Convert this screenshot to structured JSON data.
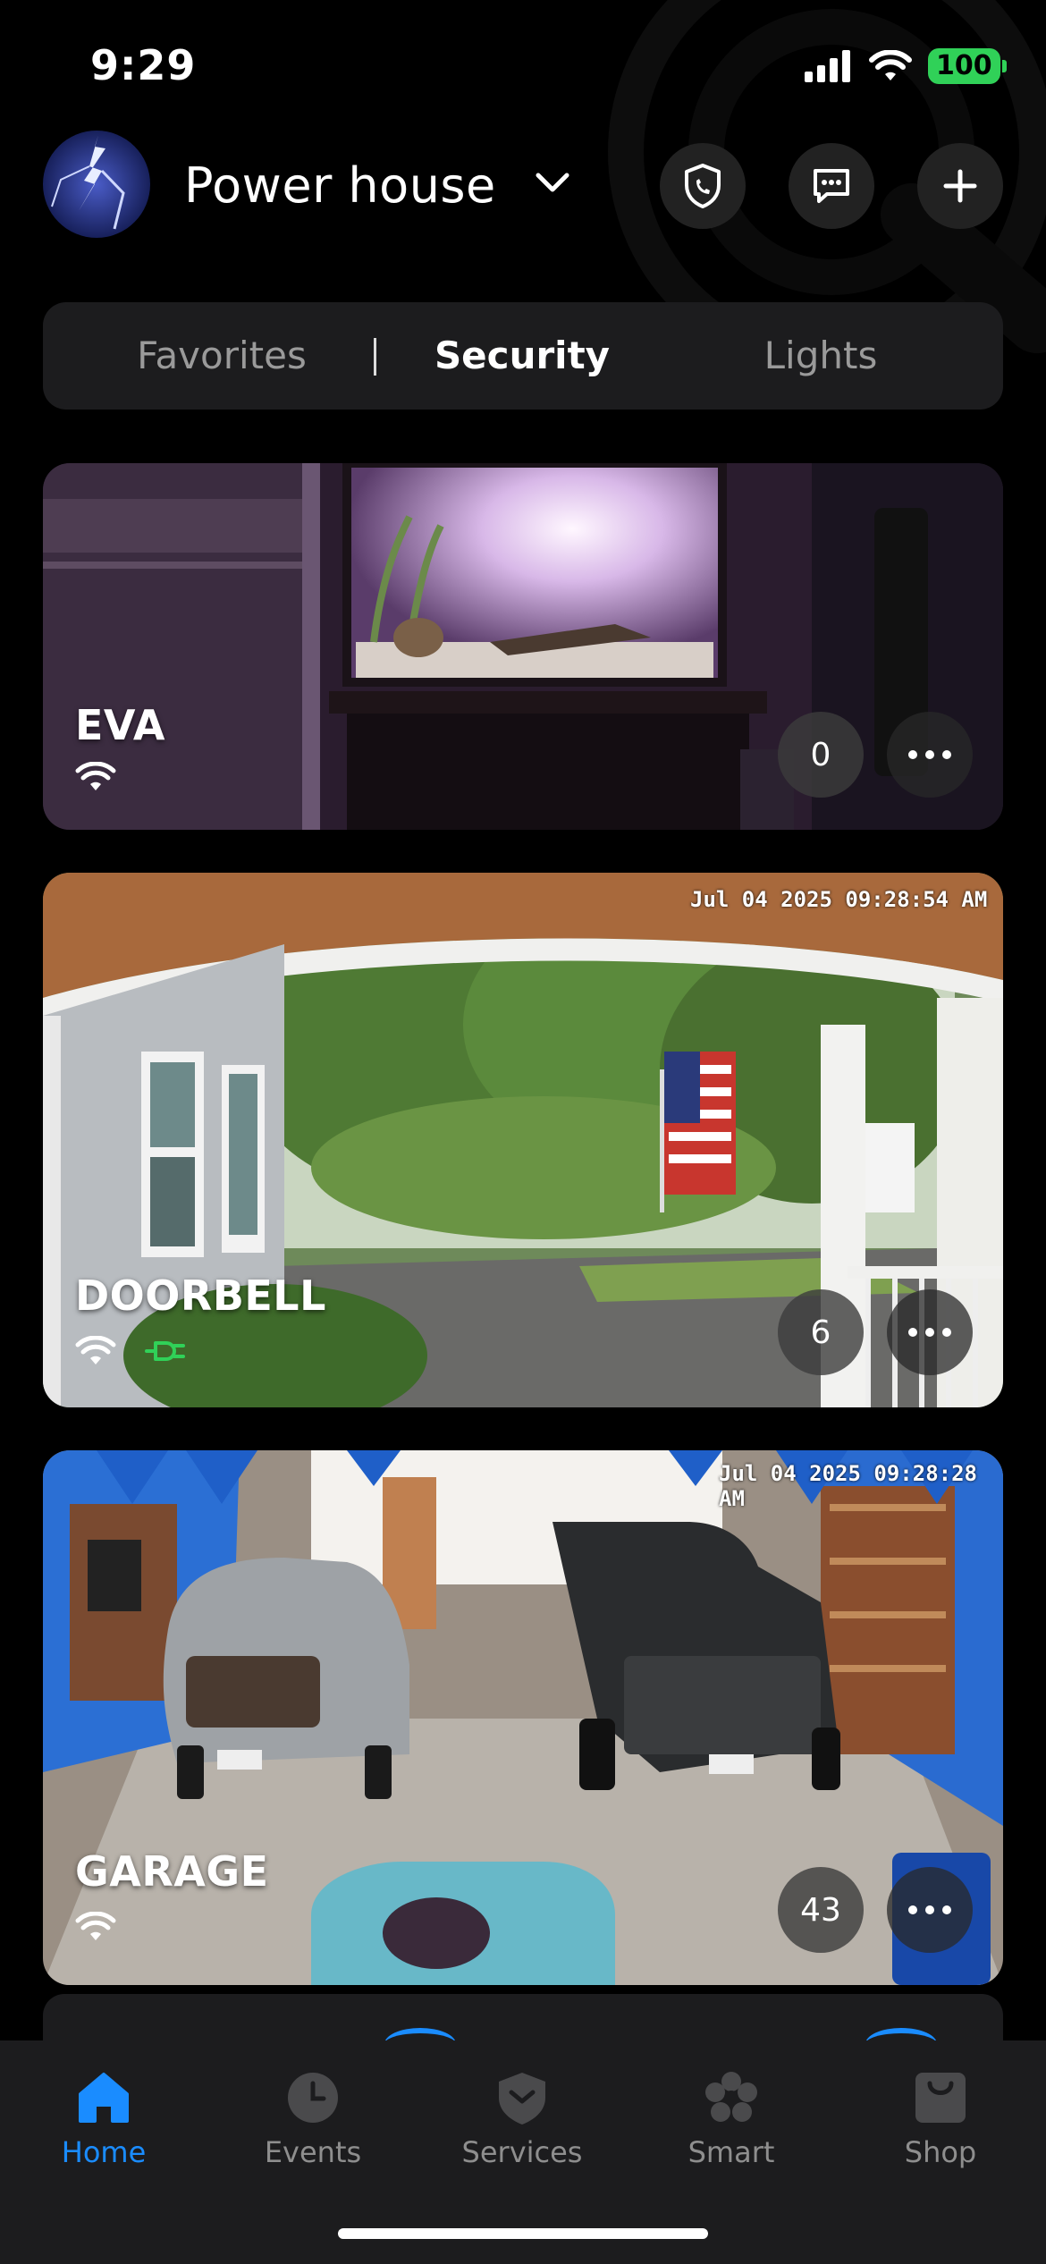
{
  "status_bar": {
    "time": "9:29",
    "battery": "100"
  },
  "header": {
    "title": "Power house",
    "icons": [
      "shield-phone-icon",
      "message-icon",
      "plus-icon"
    ]
  },
  "tabs": [
    {
      "label": "Favorites",
      "active": false
    },
    {
      "label": "Security",
      "active": true
    },
    {
      "label": "Lights",
      "active": false
    }
  ],
  "cameras": [
    {
      "name": "EVA",
      "event_count": "0",
      "timestamp": "",
      "powered": false
    },
    {
      "name": "DOORBELL",
      "event_count": "6",
      "timestamp": "Jul 04 2025  09:28:54 AM",
      "powered": true
    },
    {
      "name": "GARAGE",
      "event_count": "43",
      "timestamp": "Jul 04 2025  09:28:28 AM",
      "powered": false
    }
  ],
  "nav": [
    {
      "label": "Home",
      "icon": "home-icon",
      "active": true
    },
    {
      "label": "Events",
      "icon": "clock-icon",
      "active": false
    },
    {
      "label": "Services",
      "icon": "shield-icon",
      "active": false
    },
    {
      "label": "Smart",
      "icon": "smart-flower-icon",
      "active": false
    },
    {
      "label": "Shop",
      "icon": "shop-bag-icon",
      "active": false
    }
  ],
  "colors": {
    "accent": "#1a8cff",
    "battery": "#30d158",
    "plug": "#30d158"
  }
}
